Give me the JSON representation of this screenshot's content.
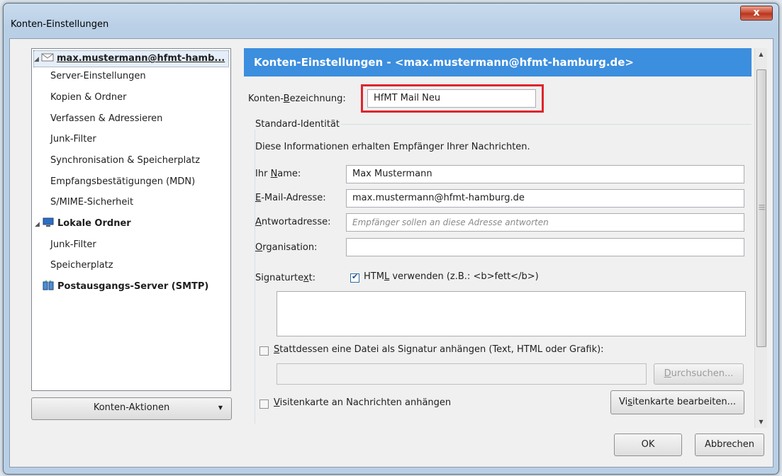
{
  "window": {
    "title": "Konten-Einstellungen",
    "close_glyph": "x"
  },
  "tree": {
    "items": [
      {
        "label": "max.mustermann@hfmt-hamb...",
        "icon": "mail-envelope-icon"
      },
      {
        "label": "Server-Einstellungen"
      },
      {
        "label": "Kopien & Ordner"
      },
      {
        "label": "Verfassen & Adressieren"
      },
      {
        "label": "Junk-Filter"
      },
      {
        "label": "Synchronisation & Speicherplatz"
      },
      {
        "label": "Empfangsbestätigungen (MDN)"
      },
      {
        "label": "S/MIME-Sicherheit"
      },
      {
        "label": "Lokale Ordner",
        "icon": "computer-icon"
      },
      {
        "label": "Junk-Filter"
      },
      {
        "label": "Speicherplatz"
      },
      {
        "label": "Postausgangs-Server (SMTP)",
        "icon": "network-server-icon"
      }
    ]
  },
  "konten_aktionen": "Konten-Aktionen",
  "panel": {
    "header": "Konten-Einstellungen - <max.mustermann@hfmt-hamburg.de>",
    "bezeichnung_label_pre": "Konten-",
    "bezeichnung_label_acc": "B",
    "bezeichnung_label_post": "ezeichnung:",
    "bezeichnung_value": "HfMT Mail Neu",
    "identity_group": "Standard-Identität",
    "identity_info": "Diese Informationen erhalten Empfänger Ihrer Nachrichten.",
    "name_label_pre": "Ihr ",
    "name_label_acc": "N",
    "name_label_post": "ame:",
    "name_value": "Max Mustermann",
    "email_label_acc": "E",
    "email_label_post": "-Mail-Adresse:",
    "email_value": "max.mustermann@hfmt-hamburg.de",
    "reply_label_acc": "A",
    "reply_label_post": "ntwortadresse:",
    "reply_placeholder": "Empfänger sollen an diese Adresse antworten",
    "org_label_acc": "O",
    "org_label_post": "rganisation:",
    "org_value": "",
    "sig_label_pre": "Signaturte",
    "sig_label_acc": "x",
    "sig_label_post": "t:",
    "html_label_pre": "HTM",
    "html_label_acc": "L",
    "html_label_post": " verwenden (z.B.: <b>fett</b>)",
    "file_sig_label_acc": "S",
    "file_sig_label_post": "tattdessen eine Datei als Signatur anhängen (Text, HTML oder Grafik):",
    "browse_label_acc": "D",
    "browse_label_post": "urchsuchen...",
    "vcard_label_acc": "V",
    "vcard_label_post": "isitenkarte an Nachrichten anhängen",
    "vcard_edit_pre": "Vi",
    "vcard_edit_acc": "s",
    "vcard_edit_post": "itenkarte bearbeiten..."
  },
  "buttons": {
    "ok": "OK",
    "cancel": "Abbrechen"
  },
  "colors": {
    "header_blue": "#3c8ede",
    "highlight_red": "#e0252b"
  }
}
